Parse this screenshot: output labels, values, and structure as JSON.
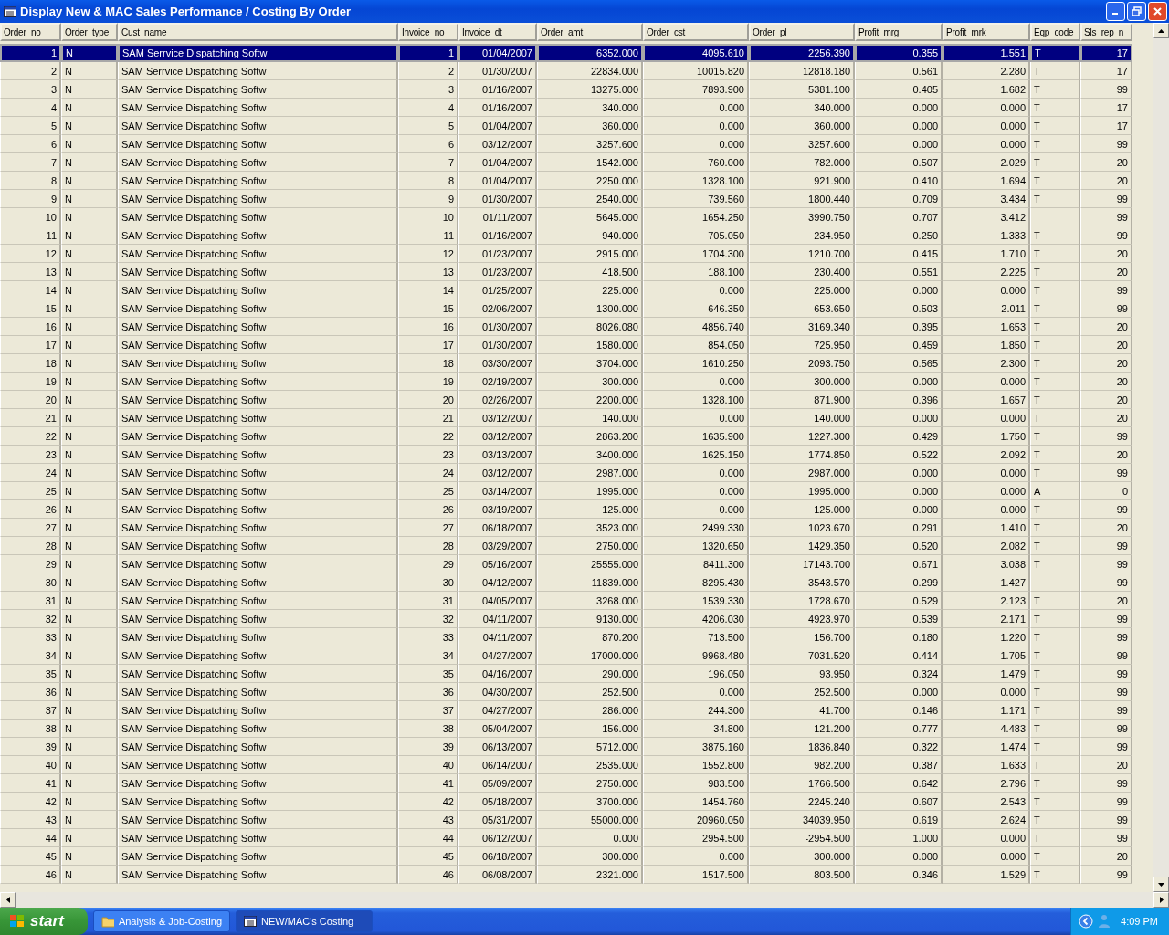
{
  "window": {
    "title": "Display New & MAC Sales Performance / Costing By Order"
  },
  "table": {
    "columns": [
      {
        "label": "Order_no",
        "kind": "number"
      },
      {
        "label": "Order_type",
        "kind": "text"
      },
      {
        "label": "Cust_name",
        "kind": "text"
      },
      {
        "label": "Invoice_no",
        "kind": "number"
      },
      {
        "label": "Invoice_dt",
        "kind": "number"
      },
      {
        "label": "Order_amt",
        "kind": "number"
      },
      {
        "label": "Order_cst",
        "kind": "number"
      },
      {
        "label": "Order_pl",
        "kind": "number"
      },
      {
        "label": "Profit_mrg",
        "kind": "number"
      },
      {
        "label": "Profit_mrk",
        "kind": "number"
      },
      {
        "label": "Eqp_code",
        "kind": "text"
      },
      {
        "label": "Sls_rep_n",
        "kind": "number"
      }
    ],
    "rows": [
      {
        "selected": true,
        "cells": [
          "1",
          "N",
          "SAM Serrvice Dispatching Softw",
          "1",
          "01/04/2007",
          "6352.000",
          "4095.610",
          "2256.390",
          "0.355",
          "1.551",
          "T",
          "17"
        ]
      },
      {
        "selected": false,
        "cells": [
          "2",
          "N",
          "SAM Serrvice Dispatching Softw",
          "2",
          "01/30/2007",
          "22834.000",
          "10015.820",
          "12818.180",
          "0.561",
          "2.280",
          "T",
          "17"
        ]
      },
      {
        "selected": false,
        "cells": [
          "3",
          "N",
          "SAM Serrvice Dispatching Softw",
          "3",
          "01/16/2007",
          "13275.000",
          "7893.900",
          "5381.100",
          "0.405",
          "1.682",
          "T",
          "99"
        ]
      },
      {
        "selected": false,
        "cells": [
          "4",
          "N",
          "SAM Serrvice Dispatching Softw",
          "4",
          "01/16/2007",
          "340.000",
          "0.000",
          "340.000",
          "0.000",
          "0.000",
          "T",
          "17"
        ]
      },
      {
        "selected": false,
        "cells": [
          "5",
          "N",
          "SAM Serrvice Dispatching Softw",
          "5",
          "01/04/2007",
          "360.000",
          "0.000",
          "360.000",
          "0.000",
          "0.000",
          "T",
          "17"
        ]
      },
      {
        "selected": false,
        "cells": [
          "6",
          "N",
          "SAM Serrvice Dispatching Softw",
          "6",
          "03/12/2007",
          "3257.600",
          "0.000",
          "3257.600",
          "0.000",
          "0.000",
          "T",
          "99"
        ]
      },
      {
        "selected": false,
        "cells": [
          "7",
          "N",
          "SAM Serrvice Dispatching Softw",
          "7",
          "01/04/2007",
          "1542.000",
          "760.000",
          "782.000",
          "0.507",
          "2.029",
          "T",
          "20"
        ]
      },
      {
        "selected": false,
        "cells": [
          "8",
          "N",
          "SAM Serrvice Dispatching Softw",
          "8",
          "01/04/2007",
          "2250.000",
          "1328.100",
          "921.900",
          "0.410",
          "1.694",
          "T",
          "20"
        ]
      },
      {
        "selected": false,
        "cells": [
          "9",
          "N",
          "SAM Serrvice Dispatching Softw",
          "9",
          "01/30/2007",
          "2540.000",
          "739.560",
          "1800.440",
          "0.709",
          "3.434",
          "T",
          "99"
        ]
      },
      {
        "selected": false,
        "cells": [
          "10",
          "N",
          "SAM Serrvice Dispatching Softw",
          "10",
          "01/11/2007",
          "5645.000",
          "1654.250",
          "3990.750",
          "0.707",
          "3.412",
          null,
          "99"
        ]
      },
      {
        "selected": false,
        "cells": [
          "11",
          "N",
          "SAM Serrvice Dispatching Softw",
          "11",
          "01/16/2007",
          "940.000",
          "705.050",
          "234.950",
          "0.250",
          "1.333",
          "T",
          "99"
        ]
      },
      {
        "selected": false,
        "cells": [
          "12",
          "N",
          "SAM Serrvice Dispatching Softw",
          "12",
          "01/23/2007",
          "2915.000",
          "1704.300",
          "1210.700",
          "0.415",
          "1.710",
          "T",
          "20"
        ]
      },
      {
        "selected": false,
        "cells": [
          "13",
          "N",
          "SAM Serrvice Dispatching Softw",
          "13",
          "01/23/2007",
          "418.500",
          "188.100",
          "230.400",
          "0.551",
          "2.225",
          "T",
          "20"
        ]
      },
      {
        "selected": false,
        "cells": [
          "14",
          "N",
          "SAM Serrvice Dispatching Softw",
          "14",
          "01/25/2007",
          "225.000",
          "0.000",
          "225.000",
          "0.000",
          "0.000",
          "T",
          "99"
        ]
      },
      {
        "selected": false,
        "cells": [
          "15",
          "N",
          "SAM Serrvice Dispatching Softw",
          "15",
          "02/06/2007",
          "1300.000",
          "646.350",
          "653.650",
          "0.503",
          "2.011",
          "T",
          "99"
        ]
      },
      {
        "selected": false,
        "cells": [
          "16",
          "N",
          "SAM Serrvice Dispatching Softw",
          "16",
          "01/30/2007",
          "8026.080",
          "4856.740",
          "3169.340",
          "0.395",
          "1.653",
          "T",
          "20"
        ]
      },
      {
        "selected": false,
        "cells": [
          "17",
          "N",
          "SAM Serrvice Dispatching Softw",
          "17",
          "01/30/2007",
          "1580.000",
          "854.050",
          "725.950",
          "0.459",
          "1.850",
          "T",
          "20"
        ]
      },
      {
        "selected": false,
        "cells": [
          "18",
          "N",
          "SAM Serrvice Dispatching Softw",
          "18",
          "03/30/2007",
          "3704.000",
          "1610.250",
          "2093.750",
          "0.565",
          "2.300",
          "T",
          "20"
        ]
      },
      {
        "selected": false,
        "cells": [
          "19",
          "N",
          "SAM Serrvice Dispatching Softw",
          "19",
          "02/19/2007",
          "300.000",
          "0.000",
          "300.000",
          "0.000",
          "0.000",
          "T",
          "20"
        ]
      },
      {
        "selected": false,
        "cells": [
          "20",
          "N",
          "SAM Serrvice Dispatching Softw",
          "20",
          "02/26/2007",
          "2200.000",
          "1328.100",
          "871.900",
          "0.396",
          "1.657",
          "T",
          "20"
        ]
      },
      {
        "selected": false,
        "cells": [
          "21",
          "N",
          "SAM Serrvice Dispatching Softw",
          "21",
          "03/12/2007",
          "140.000",
          "0.000",
          "140.000",
          "0.000",
          "0.000",
          "T",
          "20"
        ]
      },
      {
        "selected": false,
        "cells": [
          "22",
          "N",
          "SAM Serrvice Dispatching Softw",
          "22",
          "03/12/2007",
          "2863.200",
          "1635.900",
          "1227.300",
          "0.429",
          "1.750",
          "T",
          "99"
        ]
      },
      {
        "selected": false,
        "cells": [
          "23",
          "N",
          "SAM Serrvice Dispatching Softw",
          "23",
          "03/13/2007",
          "3400.000",
          "1625.150",
          "1774.850",
          "0.522",
          "2.092",
          "T",
          "20"
        ]
      },
      {
        "selected": false,
        "cells": [
          "24",
          "N",
          "SAM Serrvice Dispatching Softw",
          "24",
          "03/12/2007",
          "2987.000",
          "0.000",
          "2987.000",
          "0.000",
          "0.000",
          "T",
          "99"
        ]
      },
      {
        "selected": false,
        "cells": [
          "25",
          "N",
          "SAM Serrvice Dispatching Softw",
          "25",
          "03/14/2007",
          "1995.000",
          "0.000",
          "1995.000",
          "0.000",
          "0.000",
          "A",
          "0"
        ]
      },
      {
        "selected": false,
        "cells": [
          "26",
          "N",
          "SAM Serrvice Dispatching Softw",
          "26",
          "03/19/2007",
          "125.000",
          "0.000",
          "125.000",
          "0.000",
          "0.000",
          "T",
          "99"
        ]
      },
      {
        "selected": false,
        "cells": [
          "27",
          "N",
          "SAM Serrvice Dispatching Softw",
          "27",
          "06/18/2007",
          "3523.000",
          "2499.330",
          "1023.670",
          "0.291",
          "1.410",
          "T",
          "20"
        ]
      },
      {
        "selected": false,
        "cells": [
          "28",
          "N",
          "SAM Serrvice Dispatching Softw",
          "28",
          "03/29/2007",
          "2750.000",
          "1320.650",
          "1429.350",
          "0.520",
          "2.082",
          "T",
          "99"
        ]
      },
      {
        "selected": false,
        "cells": [
          "29",
          "N",
          "SAM Serrvice Dispatching Softw",
          "29",
          "05/16/2007",
          "25555.000",
          "8411.300",
          "17143.700",
          "0.671",
          "3.038",
          "T",
          "99"
        ]
      },
      {
        "selected": false,
        "cells": [
          "30",
          "N",
          "SAM Serrvice Dispatching Softw",
          "30",
          "04/12/2007",
          "11839.000",
          "8295.430",
          "3543.570",
          "0.299",
          "1.427",
          null,
          "99"
        ]
      },
      {
        "selected": false,
        "cells": [
          "31",
          "N",
          "SAM Serrvice Dispatching Softw",
          "31",
          "04/05/2007",
          "3268.000",
          "1539.330",
          "1728.670",
          "0.529",
          "2.123",
          "T",
          "20"
        ]
      },
      {
        "selected": false,
        "cells": [
          "32",
          "N",
          "SAM Serrvice Dispatching Softw",
          "32",
          "04/11/2007",
          "9130.000",
          "4206.030",
          "4923.970",
          "0.539",
          "2.171",
          "T",
          "99"
        ]
      },
      {
        "selected": false,
        "cells": [
          "33",
          "N",
          "SAM Serrvice Dispatching Softw",
          "33",
          "04/11/2007",
          "870.200",
          "713.500",
          "156.700",
          "0.180",
          "1.220",
          "T",
          "99"
        ]
      },
      {
        "selected": false,
        "cells": [
          "34",
          "N",
          "SAM Serrvice Dispatching Softw",
          "34",
          "04/27/2007",
          "17000.000",
          "9968.480",
          "7031.520",
          "0.414",
          "1.705",
          "T",
          "99"
        ]
      },
      {
        "selected": false,
        "cells": [
          "35",
          "N",
          "SAM Serrvice Dispatching Softw",
          "35",
          "04/16/2007",
          "290.000",
          "196.050",
          "93.950",
          "0.324",
          "1.479",
          "T",
          "99"
        ]
      },
      {
        "selected": false,
        "cells": [
          "36",
          "N",
          "SAM Serrvice Dispatching Softw",
          "36",
          "04/30/2007",
          "252.500",
          "0.000",
          "252.500",
          "0.000",
          "0.000",
          "T",
          "99"
        ]
      },
      {
        "selected": false,
        "cells": [
          "37",
          "N",
          "SAM Serrvice Dispatching Softw",
          "37",
          "04/27/2007",
          "286.000",
          "244.300",
          "41.700",
          "0.146",
          "1.171",
          "T",
          "99"
        ]
      },
      {
        "selected": false,
        "cells": [
          "38",
          "N",
          "SAM Serrvice Dispatching Softw",
          "38",
          "05/04/2007",
          "156.000",
          "34.800",
          "121.200",
          "0.777",
          "4.483",
          "T",
          "99"
        ]
      },
      {
        "selected": false,
        "cells": [
          "39",
          "N",
          "SAM Serrvice Dispatching Softw",
          "39",
          "06/13/2007",
          "5712.000",
          "3875.160",
          "1836.840",
          "0.322",
          "1.474",
          "T",
          "99"
        ]
      },
      {
        "selected": false,
        "cells": [
          "40",
          "N",
          "SAM Serrvice Dispatching Softw",
          "40",
          "06/14/2007",
          "2535.000",
          "1552.800",
          "982.200",
          "0.387",
          "1.633",
          "T",
          "20"
        ]
      },
      {
        "selected": false,
        "cells": [
          "41",
          "N",
          "SAM Serrvice Dispatching Softw",
          "41",
          "05/09/2007",
          "2750.000",
          "983.500",
          "1766.500",
          "0.642",
          "2.796",
          "T",
          "99"
        ]
      },
      {
        "selected": false,
        "cells": [
          "42",
          "N",
          "SAM Serrvice Dispatching Softw",
          "42",
          "05/18/2007",
          "3700.000",
          "1454.760",
          "2245.240",
          "0.607",
          "2.543",
          "T",
          "99"
        ]
      },
      {
        "selected": false,
        "cells": [
          "43",
          "N",
          "SAM Serrvice Dispatching Softw",
          "43",
          "05/31/2007",
          "55000.000",
          "20960.050",
          "34039.950",
          "0.619",
          "2.624",
          "T",
          "99"
        ]
      },
      {
        "selected": false,
        "cells": [
          "44",
          "N",
          "SAM Serrvice Dispatching Softw",
          "44",
          "06/12/2007",
          "0.000",
          "2954.500",
          "-2954.500",
          "1.000",
          "0.000",
          "T",
          "99"
        ]
      },
      {
        "selected": false,
        "cells": [
          "45",
          "N",
          "SAM Serrvice Dispatching Softw",
          "45",
          "06/18/2007",
          "300.000",
          "0.000",
          "300.000",
          "0.000",
          "0.000",
          "T",
          "20"
        ]
      },
      {
        "selected": false,
        "cells": [
          "46",
          "N",
          "SAM Serrvice Dispatching Softw",
          "46",
          "06/08/2007",
          "2321.000",
          "1517.500",
          "803.500",
          "0.346",
          "1.529",
          "T",
          "99"
        ]
      }
    ]
  },
  "taskbar": {
    "start": "start",
    "tasks": [
      {
        "label": "Analysis & Job-Costing",
        "kind": "folder",
        "selected": false
      },
      {
        "label": "NEW/MAC's Costing",
        "kind": "window",
        "selected": true
      }
    ],
    "clock": "4:09 PM"
  }
}
